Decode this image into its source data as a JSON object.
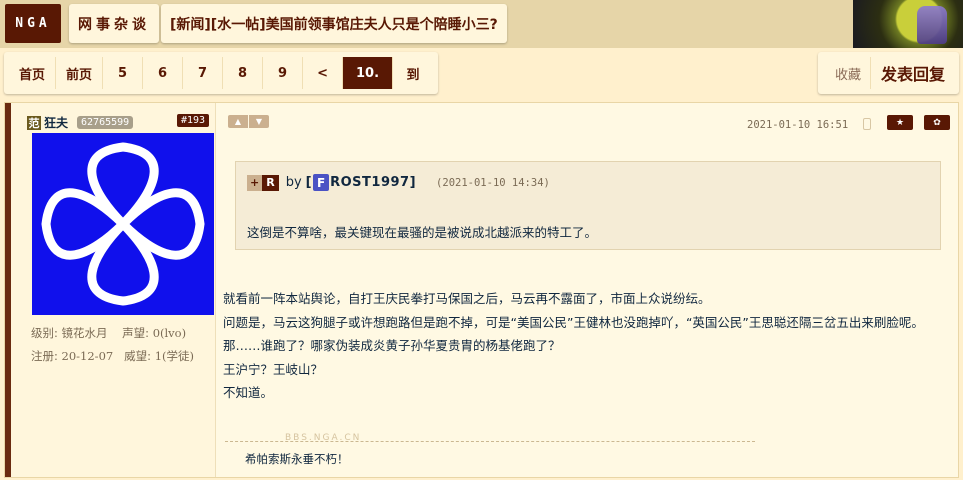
{
  "header": {
    "logo": "NGA",
    "forum": "网事杂谈",
    "thread_title": "[新闻][水一帖]美国前领事馆庄夫人只是个陪睡小三?"
  },
  "pager": {
    "items": [
      "首页",
      "前页",
      "5",
      "6",
      "7",
      "8",
      "9",
      "<",
      "10.",
      "到"
    ],
    "current": "10."
  },
  "actions": {
    "favorite": "收藏",
    "reply": "发表回复"
  },
  "post": {
    "author": {
      "tag": "范",
      "name": "狂夫",
      "uid": "62765599",
      "floor": "#193",
      "level_label": "级别:",
      "level": "镜花水月",
      "fame_label": "声望:",
      "fame": "0(lvo)",
      "reg_label": "注册:",
      "reg_date": "20-12-07",
      "prestige_label": "威望:",
      "prestige": "1(学徒)"
    },
    "time": "2021-01-10 16:51",
    "quote": {
      "plus": "+",
      "r": "R",
      "by": "by",
      "bracket_open": "[",
      "user_initial": "F",
      "user_rest": "ROST1997",
      "bracket_close": "]",
      "time": "(2021-01-10 14:34)",
      "text": "这倒是不算啥，最关键现在最骚的是被说成北越派来的特工了。"
    },
    "body": [
      "就看前一阵本站舆论，自打王庆民拳打马保国之后，马云再不露面了，市面上众说纷纭。",
      "问题是，马云这狗腿子或许想跑路但是跑不掉，可是“美国公民”王健林也没跑掉吖，“英国公民”王思聪还隔三岔五出来刷脸呢。",
      "那……谁跑了？哪家伪装成炎黄子孙华夏贵胄的杨基佬跑了？",
      "王沪宁？王岐山？",
      "不知道。"
    ],
    "signature_watermark": "BBS.NGA.CN",
    "signature": "希帕索斯永垂不朽！"
  },
  "colors": {
    "background": "#fff0cd",
    "accent": "#591804",
    "text": "#10273f",
    "avatar_bg": "#1010ec"
  }
}
